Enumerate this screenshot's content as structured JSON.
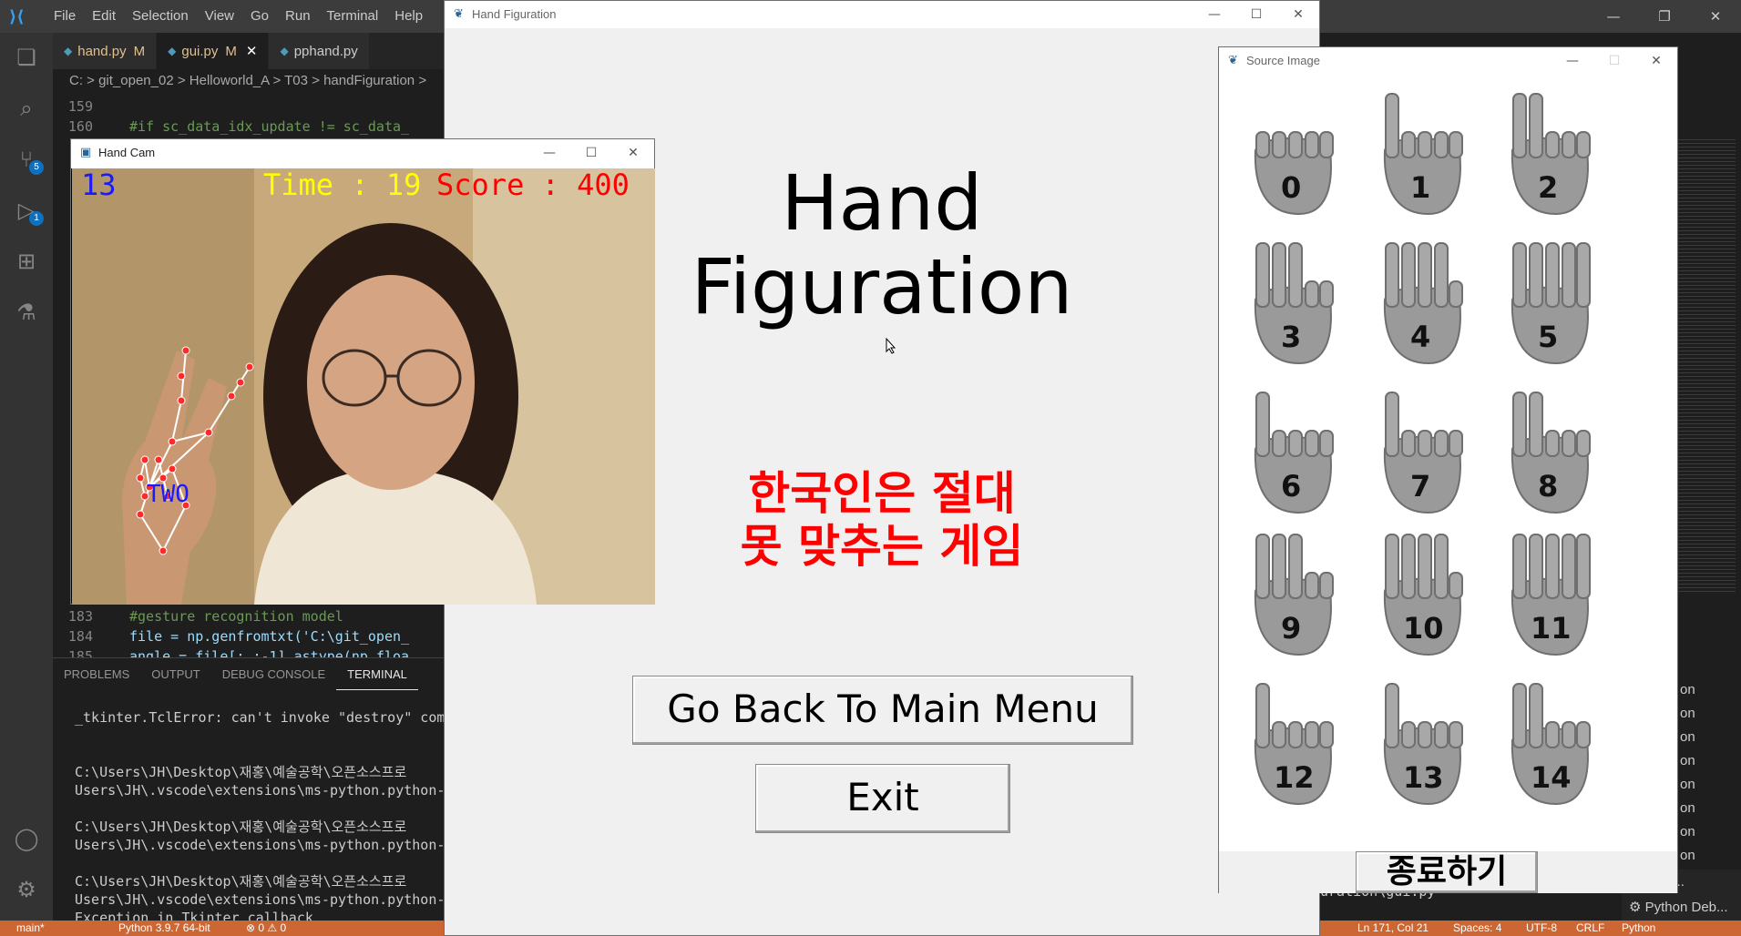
{
  "vscode": {
    "menu": [
      "File",
      "Edit",
      "Selection",
      "View",
      "Go",
      "Run",
      "Terminal",
      "Help"
    ],
    "tabs": [
      {
        "name": "hand.py",
        "flag": "M"
      },
      {
        "name": "gui.py",
        "flag": "M"
      },
      {
        "name": "pphand.py",
        "flag": ""
      }
    ],
    "breadcrumb": "C: > git_open_02 > Helloworld_A > T03 > handFiguration >",
    "badges": {
      "source_control": "5",
      "run_debug": "1"
    },
    "code": [
      {
        "ln": "159",
        "text": ""
      },
      {
        "ln": "160",
        "text": "#if sc_data_idx_update != sc_data_"
      },
      {
        "ln": "183",
        "text": "#gesture recognition model"
      },
      {
        "ln": "184",
        "text": "file = np.genfromtxt('C:\\git_open_"
      },
      {
        "ln": "185",
        "text": "angle = file[:,:-1].astype(np.floa"
      }
    ],
    "panel_tabs": [
      "PROBLEMS",
      "OUTPUT",
      "DEBUG CONSOLE",
      "TERMINAL"
    ],
    "terminal_lines": [
      "_tkinter.TclError: can't invoke \"destroy\" com",
      "",
      "C:\\Users\\JH\\Desktop\\재홍\\예술공학\\오픈소스프로",
      "Users\\JH\\.vscode\\extensions\\ms-python.python-",
      "",
      "C:\\Users\\JH\\Desktop\\재홍\\예술공학\\오픈소스프로",
      "Users\\JH\\.vscode\\extensions\\ms-python.python-",
      "",
      "C:\\Users\\JH\\Desktop\\재홍\\예술공학\\오픈소스프로",
      "Users\\JH\\.vscode\\extensions\\ms-python.python-",
      "Exception in Tkinter callback"
    ],
    "status": {
      "branch": "main*",
      "python": "Python 3.9.7 64-bit",
      "problems": "⊗ 0 ⚠ 0",
      "position": "Ln 171, Col 21",
      "spaces": "Spaces: 4",
      "encoding": "UTF-8",
      "eol": "CRLF",
      "language": "Python"
    },
    "right_panel": [
      "on",
      "on",
      "on",
      "on",
      "on",
      "on",
      "on",
      "on",
      "on Deb..."
    ],
    "right_debug": "Python Deb...",
    "gui_path": "uration\\gui.py"
  },
  "main_window": {
    "title": "Hand Figuration",
    "heading_line1": "Hand",
    "heading_line2": "Figuration",
    "korean_line1": "한국인은 절대",
    "korean_line2": "못 맞추는 게임",
    "back_button": "Go Back To Main Menu",
    "exit_button": "Exit",
    "colors": {
      "korean_text": "#ff0000"
    }
  },
  "cam_window": {
    "title": "Hand Cam",
    "frame_count": "13",
    "time_text": "Time : 19",
    "score_text": "Score : 400",
    "gesture_label": "TWO",
    "colors": {
      "frame_count": "#1a1aff",
      "time": "#ffff00",
      "score": "#ff0000",
      "gesture_label": "#1a1aff"
    }
  },
  "source_window": {
    "title": "Source Image",
    "gestures": [
      "0",
      "1",
      "2",
      "3",
      "4",
      "5",
      "6",
      "7",
      "8",
      "9",
      "10",
      "11",
      "12",
      "13",
      "14"
    ],
    "quit_button": "종료하기"
  }
}
